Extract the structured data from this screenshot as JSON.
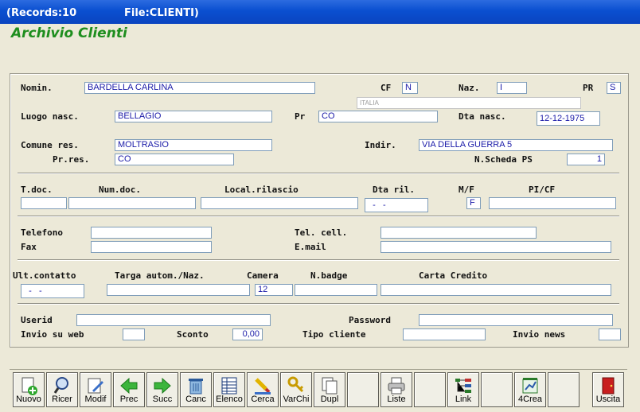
{
  "window": {
    "records": "(Records:10",
    "file": "File:CLIENTI)"
  },
  "app_title": "Archivio Clienti",
  "labels": {
    "nomin": "Nomin.",
    "cf": "CF",
    "naz": "Naz.",
    "pr": "PR",
    "luogo_nasc": "Luogo nasc.",
    "pr2": "Pr",
    "dta_nasc": "Dta nasc.",
    "comune_res": "Comune res.",
    "indir": "Indir.",
    "pr_res": "Pr.res.",
    "n_scheda": "N.Scheda PS",
    "t_doc": "T.doc.",
    "num_doc": "Num.doc.",
    "local_rilascio": "Local.rilascio",
    "dta_ril": "Dta ril.",
    "mf": "M/F",
    "picf": "PI/CF",
    "telefono": "Telefono",
    "tel_cell": "Tel. cell.",
    "fax": "Fax",
    "email": "E.mail",
    "ult_contatto": "Ult.contatto",
    "targa": "Targa autom./Naz.",
    "camera": "Camera",
    "nbadge": "N.badge",
    "carta_credito": "Carta Credito",
    "userid": "Userid",
    "password": "Password",
    "invio_web": "Invio su web",
    "sconto": "Sconto",
    "tipo_cliente": "Tipo cliente",
    "invio_news": "Invio news"
  },
  "values": {
    "nomin": "BARDELLA CARLINA",
    "cf": "N",
    "naz": "I",
    "pr": "S",
    "naz_desc": "ITALIA",
    "luogo_nasc": "BELLAGIO",
    "pr2": "CO",
    "dta_nasc": "12-12-1975",
    "comune_res": "MOLTRASIO",
    "indir": "VIA DELLA GUERRA 5",
    "pr_res": "CO",
    "n_scheda": "1",
    "t_doc": "",
    "num_doc": "",
    "local_rilascio": "",
    "dta_ril": "  -   -",
    "mf": "F",
    "picf": "",
    "telefono": "",
    "tel_cell": "",
    "fax": "",
    "email": "",
    "ult_contatto": "  -   -",
    "targa": "",
    "camera": "12",
    "nbadge": "",
    "carta_credito": "",
    "userid": "",
    "password": "",
    "invio_web": "",
    "sconto": "0,00",
    "tipo_cliente": "",
    "invio_news": ""
  },
  "toolbar": {
    "nuovo": "Nuovo",
    "ricer": "Ricer",
    "modif": "Modif",
    "prec": "Prec",
    "succ": "Succ",
    "canc": "Canc",
    "elenco": "Elenco",
    "cerca": "Cerca",
    "varchi": "VarChi",
    "dupl": "Dupl",
    "liste": "Liste",
    "link": "Link",
    "crea4": "4Crea",
    "uscita": "Uscita"
  }
}
